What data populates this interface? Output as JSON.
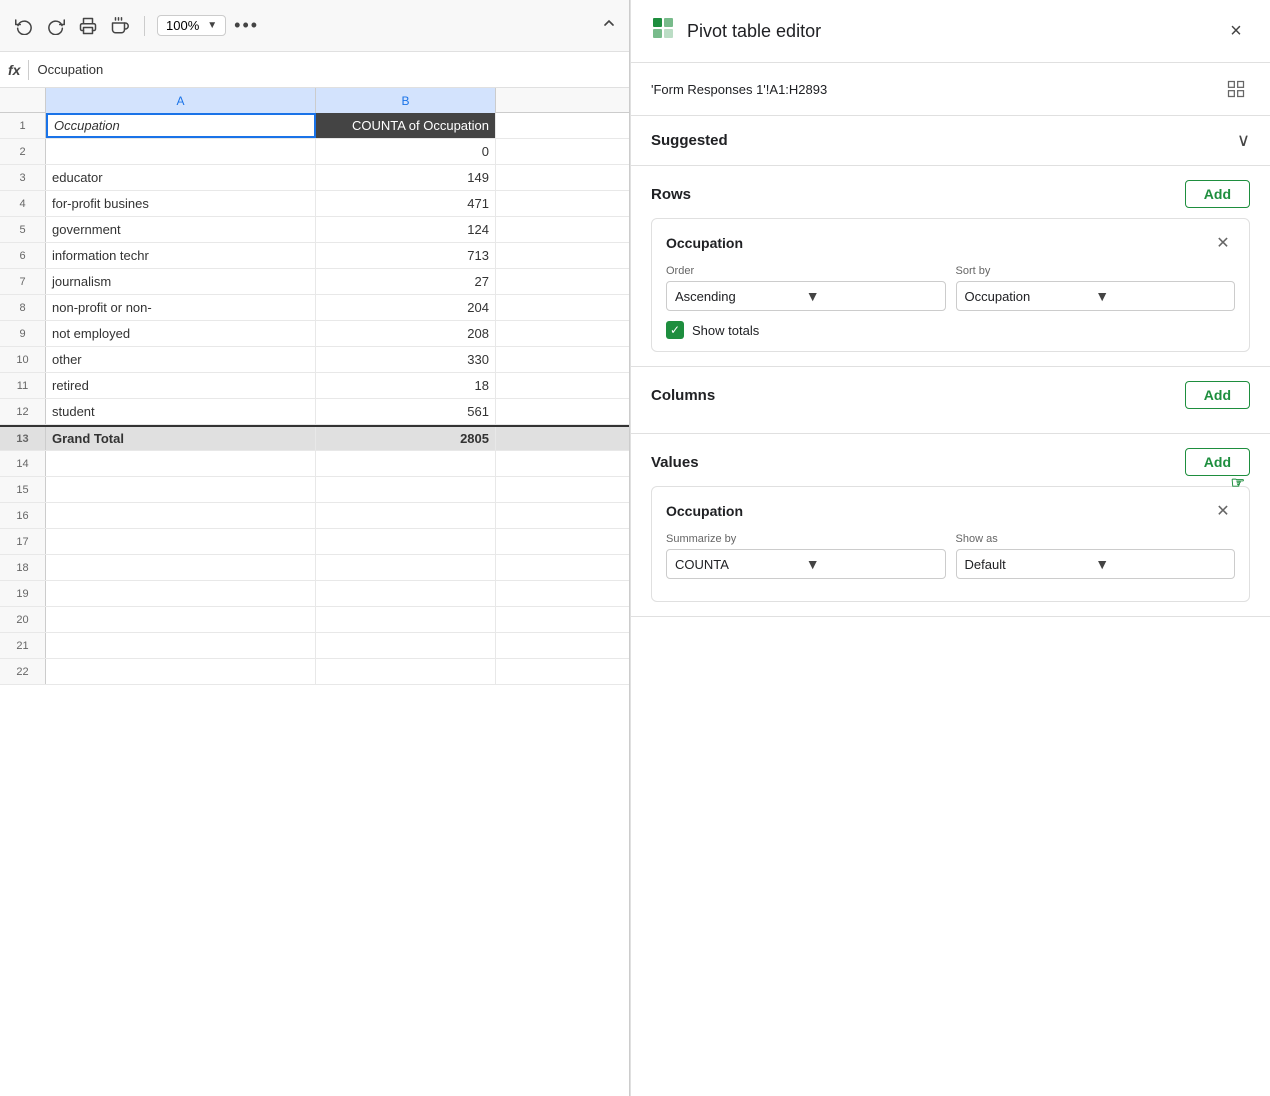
{
  "toolbar": {
    "undo_label": "↺",
    "redo_label": "↻",
    "print_label": "⎙",
    "paint_label": "🖌",
    "zoom_value": "100%",
    "more_label": "•••",
    "collapse_label": "∧"
  },
  "formula_bar": {
    "fx_label": "fx",
    "value": "Occupation"
  },
  "columns": [
    {
      "id": "A",
      "label": "A",
      "selected": true
    },
    {
      "id": "B",
      "label": "B",
      "selected": true
    }
  ],
  "rows": [
    {
      "num": 1,
      "col_a": "Occupation",
      "col_b": "COUNTA of Occupation",
      "is_header": true
    },
    {
      "num": 2,
      "col_a": "",
      "col_b": "0",
      "is_header": false
    },
    {
      "num": 3,
      "col_a": "educator",
      "col_b": "149",
      "is_header": false
    },
    {
      "num": 4,
      "col_a": "for-profit busines",
      "col_b": "471",
      "is_header": false
    },
    {
      "num": 5,
      "col_a": "government",
      "col_b": "124",
      "is_header": false
    },
    {
      "num": 6,
      "col_a": "information techr",
      "col_b": "713",
      "is_header": false
    },
    {
      "num": 7,
      "col_a": "journalism",
      "col_b": "27",
      "is_header": false
    },
    {
      "num": 8,
      "col_a": "non-profit or non-",
      "col_b": "204",
      "is_header": false
    },
    {
      "num": 9,
      "col_a": "not employed",
      "col_b": "208",
      "is_header": false
    },
    {
      "num": 10,
      "col_a": "other",
      "col_b": "330",
      "is_header": false
    },
    {
      "num": 11,
      "col_a": "retired",
      "col_b": "18",
      "is_header": false
    },
    {
      "num": 12,
      "col_a": "student",
      "col_b": "561",
      "is_header": false
    },
    {
      "num": 13,
      "col_a": "Grand Total",
      "col_b": "2805",
      "is_header": false,
      "is_grand_total": true
    },
    {
      "num": 14,
      "col_a": "",
      "col_b": "",
      "is_header": false
    },
    {
      "num": 15,
      "col_a": "",
      "col_b": "",
      "is_header": false
    },
    {
      "num": 16,
      "col_a": "",
      "col_b": "",
      "is_header": false
    },
    {
      "num": 17,
      "col_a": "",
      "col_b": "",
      "is_header": false
    },
    {
      "num": 18,
      "col_a": "",
      "col_b": "",
      "is_header": false
    },
    {
      "num": 19,
      "col_a": "",
      "col_b": "",
      "is_header": false
    },
    {
      "num": 20,
      "col_a": "",
      "col_b": "",
      "is_header": false
    },
    {
      "num": 21,
      "col_a": "",
      "col_b": "",
      "is_header": false
    },
    {
      "num": 22,
      "col_a": "",
      "col_b": "",
      "is_header": false
    }
  ],
  "pivot_editor": {
    "title": "Pivot table editor",
    "close_label": "×",
    "range_text": "'Form Responses 1'!A1:H2893",
    "suggested_label": "Suggested",
    "rows_label": "Rows",
    "add_label": "Add",
    "rows_card": {
      "title": "Occupation",
      "order_label": "Order",
      "order_value": "Ascending",
      "sort_by_label": "Sort by",
      "sort_by_value": "Occupation",
      "show_totals_label": "Show totals",
      "show_totals_checked": true
    },
    "columns_label": "Columns",
    "columns_add_label": "Add",
    "values_label": "Values",
    "values_add_label": "Add",
    "values_card": {
      "title": "Occupation",
      "summarize_by_label": "Summarize by",
      "summarize_by_value": "COUNTA",
      "show_as_label": "Show as",
      "show_as_value": "Default"
    }
  }
}
